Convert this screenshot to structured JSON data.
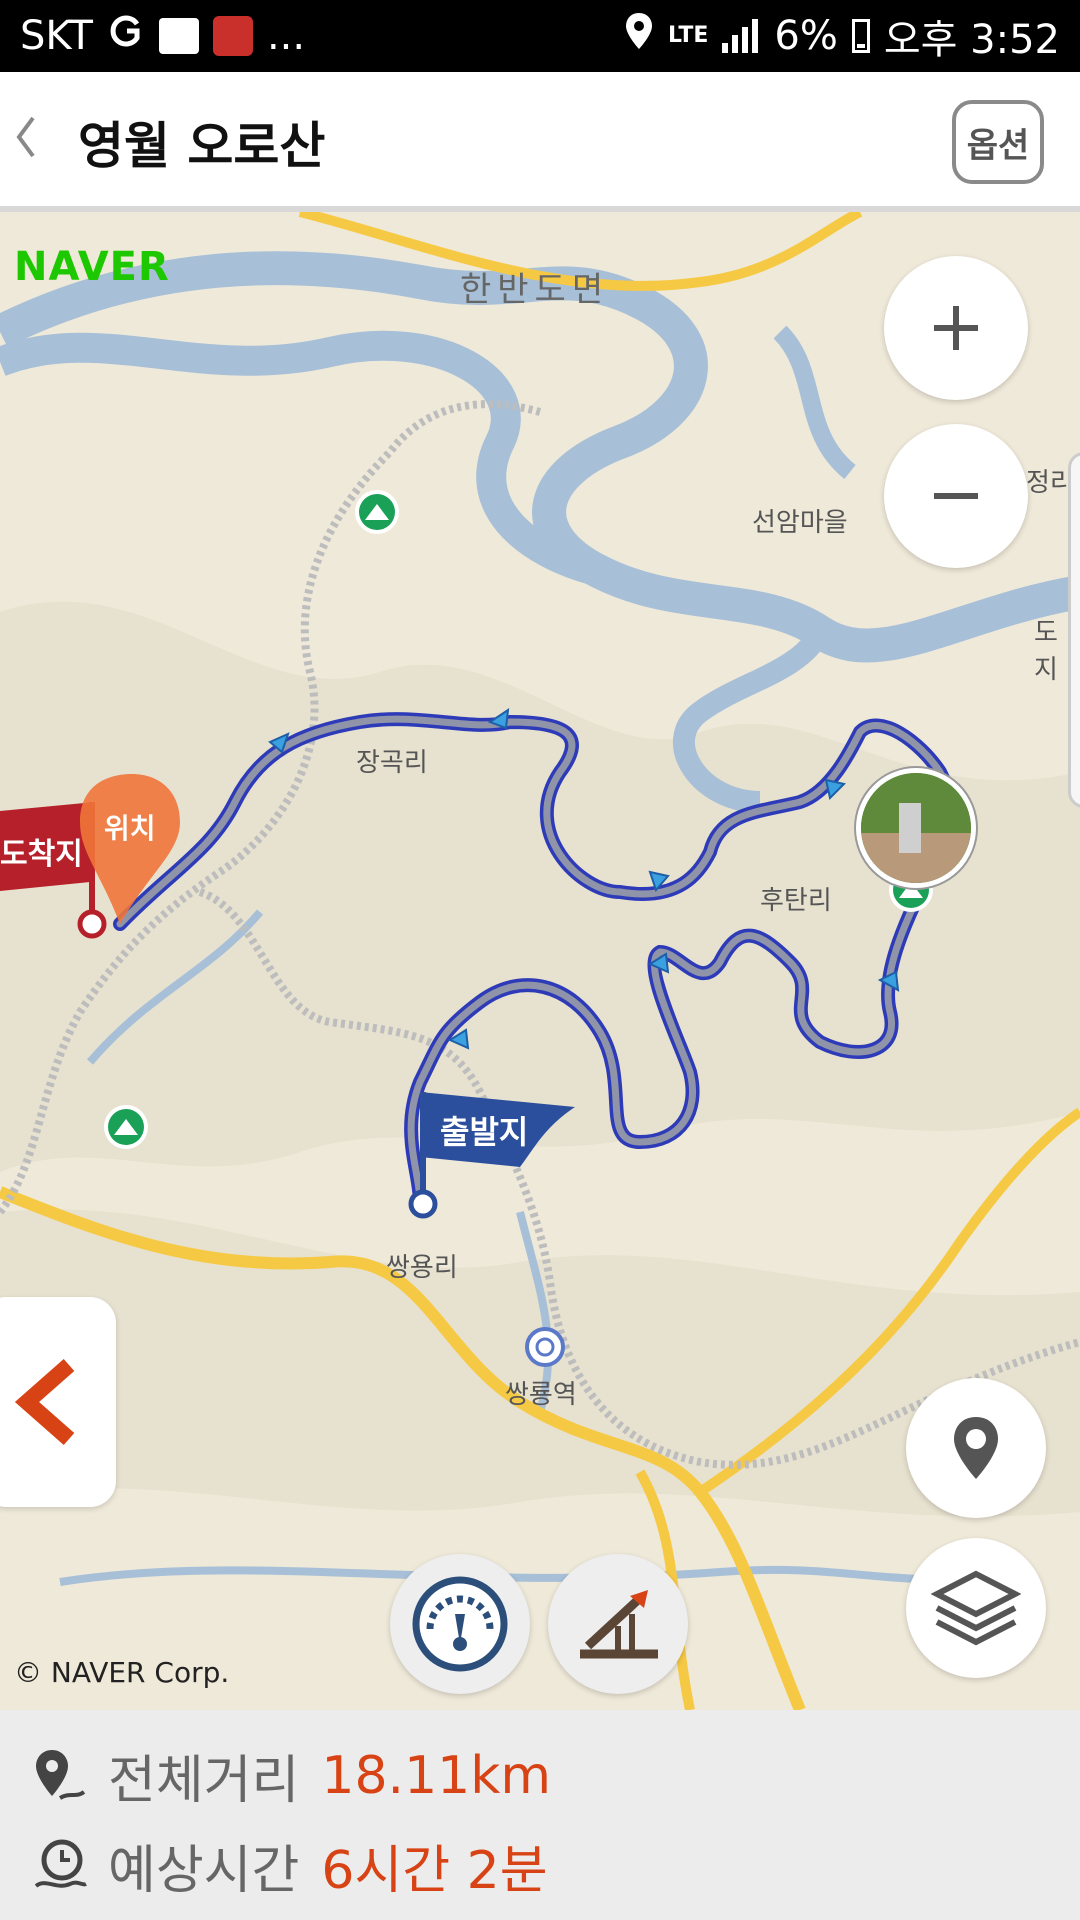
{
  "status_bar": {
    "carrier": "SKT",
    "more": "...",
    "network": "LTE",
    "battery": "6%",
    "time": "오후 3:52"
  },
  "header": {
    "back_icon": "chevron-left-icon",
    "title": "영월 오로산",
    "option_label": "옵션"
  },
  "map": {
    "provider_logo": "NAVER",
    "labels": {
      "hanbando": "한반도면",
      "seonam": "선암마을",
      "janggok": "장곡리",
      "hutan": "후탄리",
      "ssangyong": "쌍용리",
      "ssangyong_station": "쌍룡역",
      "jeong": "정리",
      "do": "도지"
    },
    "markers": {
      "arrival": "도착지",
      "location": "위치",
      "departure": "출발지"
    },
    "copyright": "© NAVER Corp.",
    "route_color": "#3a47c9",
    "controls": [
      "zoom-in-icon",
      "zoom-out-icon",
      "location-pin-icon",
      "layers-icon",
      "speedometer-icon",
      "slope-icon",
      "back-arrow-icon"
    ]
  },
  "summary": {
    "distance_label": "전체거리",
    "distance_value": "18.11km",
    "time_label": "예상시간",
    "time_value": "6시간 2분"
  }
}
